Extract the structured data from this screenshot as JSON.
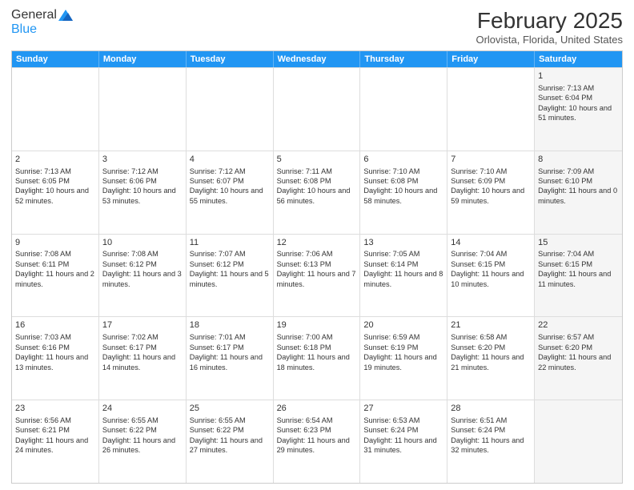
{
  "logo": {
    "general": "General",
    "blue": "Blue"
  },
  "header": {
    "title": "February 2025",
    "subtitle": "Orlovista, Florida, United States"
  },
  "weekdays": [
    "Sunday",
    "Monday",
    "Tuesday",
    "Wednesday",
    "Thursday",
    "Friday",
    "Saturday"
  ],
  "weeks": [
    [
      {
        "day": "",
        "info": "",
        "shaded": false
      },
      {
        "day": "",
        "info": "",
        "shaded": false
      },
      {
        "day": "",
        "info": "",
        "shaded": false
      },
      {
        "day": "",
        "info": "",
        "shaded": false
      },
      {
        "day": "",
        "info": "",
        "shaded": false
      },
      {
        "day": "",
        "info": "",
        "shaded": false
      },
      {
        "day": "1",
        "info": "Sunrise: 7:13 AM\nSunset: 6:04 PM\nDaylight: 10 hours and 51 minutes.",
        "shaded": true
      }
    ],
    [
      {
        "day": "2",
        "info": "Sunrise: 7:13 AM\nSunset: 6:05 PM\nDaylight: 10 hours and 52 minutes.",
        "shaded": false
      },
      {
        "day": "3",
        "info": "Sunrise: 7:12 AM\nSunset: 6:06 PM\nDaylight: 10 hours and 53 minutes.",
        "shaded": false
      },
      {
        "day": "4",
        "info": "Sunrise: 7:12 AM\nSunset: 6:07 PM\nDaylight: 10 hours and 55 minutes.",
        "shaded": false
      },
      {
        "day": "5",
        "info": "Sunrise: 7:11 AM\nSunset: 6:08 PM\nDaylight: 10 hours and 56 minutes.",
        "shaded": false
      },
      {
        "day": "6",
        "info": "Sunrise: 7:10 AM\nSunset: 6:08 PM\nDaylight: 10 hours and 58 minutes.",
        "shaded": false
      },
      {
        "day": "7",
        "info": "Sunrise: 7:10 AM\nSunset: 6:09 PM\nDaylight: 10 hours and 59 minutes.",
        "shaded": false
      },
      {
        "day": "8",
        "info": "Sunrise: 7:09 AM\nSunset: 6:10 PM\nDaylight: 11 hours and 0 minutes.",
        "shaded": true
      }
    ],
    [
      {
        "day": "9",
        "info": "Sunrise: 7:08 AM\nSunset: 6:11 PM\nDaylight: 11 hours and 2 minutes.",
        "shaded": false
      },
      {
        "day": "10",
        "info": "Sunrise: 7:08 AM\nSunset: 6:12 PM\nDaylight: 11 hours and 3 minutes.",
        "shaded": false
      },
      {
        "day": "11",
        "info": "Sunrise: 7:07 AM\nSunset: 6:12 PM\nDaylight: 11 hours and 5 minutes.",
        "shaded": false
      },
      {
        "day": "12",
        "info": "Sunrise: 7:06 AM\nSunset: 6:13 PM\nDaylight: 11 hours and 7 minutes.",
        "shaded": false
      },
      {
        "day": "13",
        "info": "Sunrise: 7:05 AM\nSunset: 6:14 PM\nDaylight: 11 hours and 8 minutes.",
        "shaded": false
      },
      {
        "day": "14",
        "info": "Sunrise: 7:04 AM\nSunset: 6:15 PM\nDaylight: 11 hours and 10 minutes.",
        "shaded": false
      },
      {
        "day": "15",
        "info": "Sunrise: 7:04 AM\nSunset: 6:15 PM\nDaylight: 11 hours and 11 minutes.",
        "shaded": true
      }
    ],
    [
      {
        "day": "16",
        "info": "Sunrise: 7:03 AM\nSunset: 6:16 PM\nDaylight: 11 hours and 13 minutes.",
        "shaded": false
      },
      {
        "day": "17",
        "info": "Sunrise: 7:02 AM\nSunset: 6:17 PM\nDaylight: 11 hours and 14 minutes.",
        "shaded": false
      },
      {
        "day": "18",
        "info": "Sunrise: 7:01 AM\nSunset: 6:17 PM\nDaylight: 11 hours and 16 minutes.",
        "shaded": false
      },
      {
        "day": "19",
        "info": "Sunrise: 7:00 AM\nSunset: 6:18 PM\nDaylight: 11 hours and 18 minutes.",
        "shaded": false
      },
      {
        "day": "20",
        "info": "Sunrise: 6:59 AM\nSunset: 6:19 PM\nDaylight: 11 hours and 19 minutes.",
        "shaded": false
      },
      {
        "day": "21",
        "info": "Sunrise: 6:58 AM\nSunset: 6:20 PM\nDaylight: 11 hours and 21 minutes.",
        "shaded": false
      },
      {
        "day": "22",
        "info": "Sunrise: 6:57 AM\nSunset: 6:20 PM\nDaylight: 11 hours and 22 minutes.",
        "shaded": true
      }
    ],
    [
      {
        "day": "23",
        "info": "Sunrise: 6:56 AM\nSunset: 6:21 PM\nDaylight: 11 hours and 24 minutes.",
        "shaded": false
      },
      {
        "day": "24",
        "info": "Sunrise: 6:55 AM\nSunset: 6:22 PM\nDaylight: 11 hours and 26 minutes.",
        "shaded": false
      },
      {
        "day": "25",
        "info": "Sunrise: 6:55 AM\nSunset: 6:22 PM\nDaylight: 11 hours and 27 minutes.",
        "shaded": false
      },
      {
        "day": "26",
        "info": "Sunrise: 6:54 AM\nSunset: 6:23 PM\nDaylight: 11 hours and 29 minutes.",
        "shaded": false
      },
      {
        "day": "27",
        "info": "Sunrise: 6:53 AM\nSunset: 6:24 PM\nDaylight: 11 hours and 31 minutes.",
        "shaded": false
      },
      {
        "day": "28",
        "info": "Sunrise: 6:51 AM\nSunset: 6:24 PM\nDaylight: 11 hours and 32 minutes.",
        "shaded": false
      },
      {
        "day": "",
        "info": "",
        "shaded": true
      }
    ]
  ]
}
